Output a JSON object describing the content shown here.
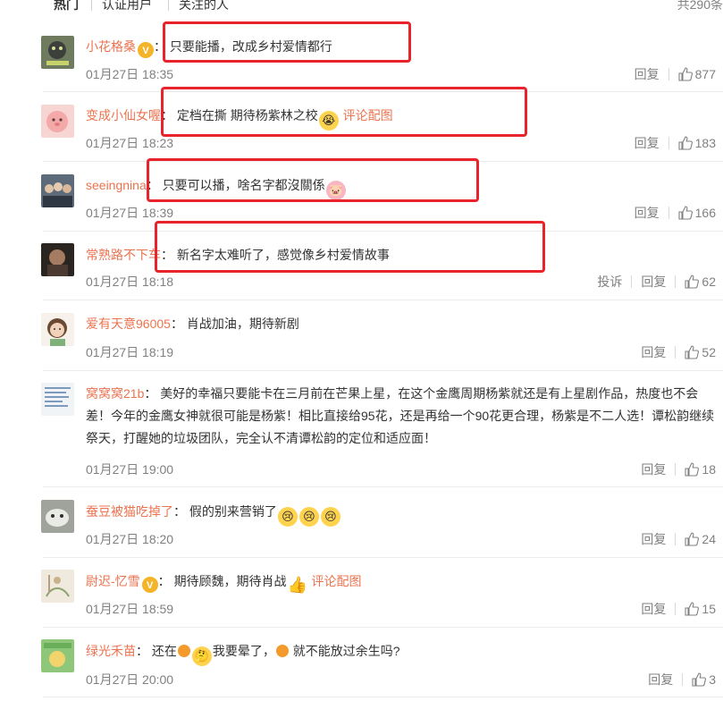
{
  "tabs": [
    {
      "label": "热门",
      "active": true
    },
    {
      "label": "认证用户",
      "active": false
    },
    {
      "label": "关注的人",
      "active": false
    }
  ],
  "total_label": "共290条",
  "colon": "：",
  "comments": [
    {
      "user": "小花格桑",
      "verified": true,
      "text": "只要能播，改成乡村爱情都行",
      "time": "01月27日 18:35",
      "reply": "回复",
      "likes": "877"
    },
    {
      "user": "变成小仙女喔",
      "verified": false,
      "text": "定档在撕 期待杨紫林之校",
      "emoji": "cry-face",
      "pic_link": "评论配图",
      "time": "01月27日 18:23",
      "reply": "回复",
      "likes": "183"
    },
    {
      "user": "seeingnina",
      "verified": false,
      "text": "只要可以播，啥名字都沒關係",
      "emoji": "pig-face",
      "time": "01月27日 18:39",
      "reply": "回复",
      "likes": "166"
    },
    {
      "user": "常熟路不下车",
      "verified": false,
      "text": "新名字太难听了，感觉像乡村爱情故事",
      "time": "01月27日 18:18",
      "report": "投诉",
      "reply": "回复",
      "likes": "62"
    },
    {
      "user": "爱有天意96005",
      "verified": false,
      "text": "肖战加油，期待新剧",
      "time": "01月27日 18:19",
      "reply": "回复",
      "likes": "52"
    },
    {
      "user": "窝窝窝21b",
      "verified": false,
      "text": "美好的幸福只要能卡在三月前在芒果上星，在这个金鹰周期杨紫就还是有上星剧作品，热度也不会差！今年的金鹰女神就很可能是杨紫！相比直接给95花，还是再给一个90花更合理，杨紫是不二人选！谭松韵继续祭天，打醒她的垃圾团队，完全认不清谭松韵的定位和适应面！",
      "time": "01月27日 19:00",
      "reply": "回复",
      "likes": "18"
    },
    {
      "user": "蚕豆被猫吃掉了",
      "verified": false,
      "text": "假的别来营销了",
      "emoji": "cry-face x3",
      "time": "01月27日 18:20",
      "reply": "回复",
      "likes": "24"
    },
    {
      "user": "尉迟-忆雪",
      "verified": true,
      "text": "期待顾魏，期待肖战",
      "emoji": "thumbs-up",
      "pic_link": "评论配图",
      "time": "01月27日 18:59",
      "reply": "回复",
      "likes": "15"
    },
    {
      "user": "绿光禾苗",
      "verified": false,
      "text_a": "还在",
      "text_b": "我要晕了，",
      "text_c": "就不能放过余生吗?",
      "time": "01月27日 20:00",
      "reply": "回复",
      "likes": "3"
    }
  ],
  "colors": {
    "username": "#eb7350",
    "meta": "#808080",
    "annotation": "#e8232b",
    "verified": "#f4b42a"
  }
}
